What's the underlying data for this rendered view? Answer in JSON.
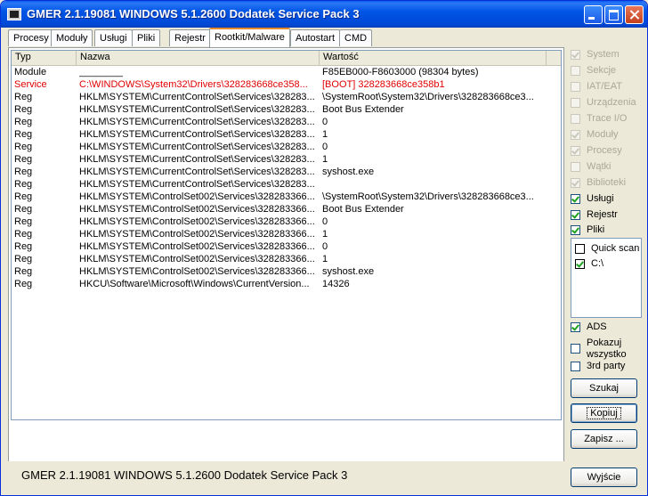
{
  "window": {
    "title": "GMER 2.1.19081     WINDOWS 5.1.2600 Dodatek Service Pack 3"
  },
  "tabs": [
    {
      "label": "Procesy"
    },
    {
      "label": "Moduły"
    },
    {
      "label": "Usługi"
    },
    {
      "label": "Pliki"
    },
    {
      "label": "Rejestr"
    },
    {
      "label": "Rootkit/Malware"
    },
    {
      "label": "Autostart"
    },
    {
      "label": "CMD"
    }
  ],
  "table": {
    "headers": [
      "Typ",
      "Nazwa",
      "Wartość"
    ],
    "rows": [
      {
        "type": "Module",
        "name": "________",
        "value": "F85EB000-F8603000 (98304 bytes)"
      },
      {
        "type": "Service",
        "name": "C:\\WINDOWS\\System32\\Drivers\\328283668ce358...",
        "value": "[BOOT] 328283668ce358b1"
      },
      {
        "type": "Reg",
        "name": "HKLM\\SYSTEM\\CurrentControlSet\\Services\\328283...",
        "value": "\\SystemRoot\\System32\\Drivers\\328283668ce3..."
      },
      {
        "type": "Reg",
        "name": "HKLM\\SYSTEM\\CurrentControlSet\\Services\\328283...",
        "value": "Boot Bus Extender"
      },
      {
        "type": "Reg",
        "name": "HKLM\\SYSTEM\\CurrentControlSet\\Services\\328283...",
        "value": "0"
      },
      {
        "type": "Reg",
        "name": "HKLM\\SYSTEM\\CurrentControlSet\\Services\\328283...",
        "value": "1"
      },
      {
        "type": "Reg",
        "name": "HKLM\\SYSTEM\\CurrentControlSet\\Services\\328283...",
        "value": "0"
      },
      {
        "type": "Reg",
        "name": "HKLM\\SYSTEM\\CurrentControlSet\\Services\\328283...",
        "value": "1"
      },
      {
        "type": "Reg",
        "name": "HKLM\\SYSTEM\\CurrentControlSet\\Services\\328283...",
        "value": "syshost.exe"
      },
      {
        "type": "Reg",
        "name": "HKLM\\SYSTEM\\CurrentControlSet\\Services\\328283...",
        "value": ""
      },
      {
        "type": "Reg",
        "name": "HKLM\\SYSTEM\\ControlSet002\\Services\\328283366...",
        "value": "\\SystemRoot\\System32\\Drivers\\328283668ce3..."
      },
      {
        "type": "Reg",
        "name": "HKLM\\SYSTEM\\ControlSet002\\Services\\328283366...",
        "value": "Boot Bus Extender"
      },
      {
        "type": "Reg",
        "name": "HKLM\\SYSTEM\\ControlSet002\\Services\\328283366...",
        "value": "0"
      },
      {
        "type": "Reg",
        "name": "HKLM\\SYSTEM\\ControlSet002\\Services\\328283366...",
        "value": "1"
      },
      {
        "type": "Reg",
        "name": "HKLM\\SYSTEM\\ControlSet002\\Services\\328283366...",
        "value": "0"
      },
      {
        "type": "Reg",
        "name": "HKLM\\SYSTEM\\ControlSet002\\Services\\328283366...",
        "value": "1"
      },
      {
        "type": "Reg",
        "name": "HKLM\\SYSTEM\\ControlSet002\\Services\\328283366...",
        "value": "syshost.exe"
      },
      {
        "type": "Reg",
        "name": "HKCU\\Software\\Microsoft\\Windows\\CurrentVersion...",
        "value": "14326"
      }
    ]
  },
  "sidebar": {
    "options": [
      {
        "label": "System",
        "checked": true,
        "enabled": false
      },
      {
        "label": "Sekcje",
        "checked": false,
        "enabled": false
      },
      {
        "label": "IAT/EAT",
        "checked": false,
        "enabled": false
      },
      {
        "label": "Urządzenia",
        "checked": false,
        "enabled": false
      },
      {
        "label": "Trace I/O",
        "checked": false,
        "enabled": false
      },
      {
        "label": "Moduły",
        "checked": true,
        "enabled": false
      },
      {
        "label": "Procesy",
        "checked": true,
        "enabled": false
      },
      {
        "label": "Wątki",
        "checked": false,
        "enabled": false
      },
      {
        "label": "Biblioteki",
        "checked": true,
        "enabled": false
      },
      {
        "label": "Usługi",
        "checked": true,
        "enabled": true
      },
      {
        "label": "Rejestr",
        "checked": true,
        "enabled": true
      },
      {
        "label": "Pliki",
        "checked": true,
        "enabled": true
      }
    ],
    "scan": [
      {
        "label": "Quick scan",
        "checked": false
      },
      {
        "label": "C:\\",
        "checked": true
      }
    ],
    "extra": [
      {
        "label": "ADS",
        "checked": true
      },
      {
        "label": "Pokazuj wszystko",
        "checked": false
      },
      {
        "label": "3rd party",
        "checked": false
      }
    ],
    "buttons": {
      "scan": "Szukaj",
      "copy": "Kopiuj",
      "save": "Zapisz ..."
    }
  },
  "status": {
    "text": "GMER 2.1.19081     WINDOWS 5.1.2600 Dodatek Service Pack 3",
    "exit": "Wyjście"
  }
}
